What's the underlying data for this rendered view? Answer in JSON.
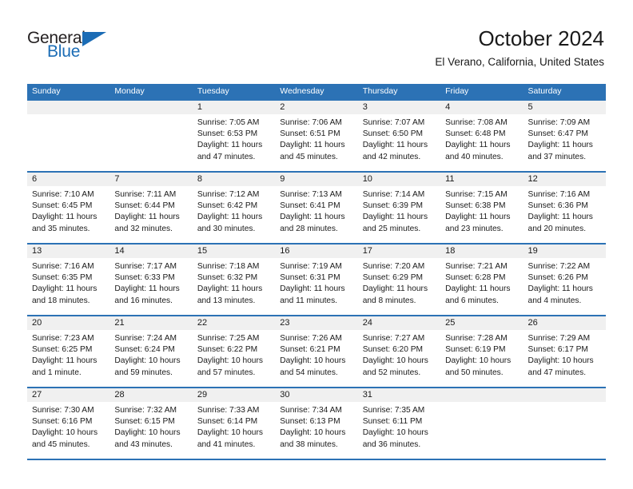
{
  "brand": {
    "name_dark": "General",
    "name_blue": "Blue",
    "accent_color": "#1b6cb5"
  },
  "header": {
    "title": "October 2024",
    "location": "El Verano, California, United States"
  },
  "theme": {
    "header_blue": "#2c72b5",
    "band_gray": "#f0f0f0",
    "text_color": "#1a1a1a"
  },
  "calendar": {
    "weekday_headers": [
      "Sunday",
      "Monday",
      "Tuesday",
      "Wednesday",
      "Thursday",
      "Friday",
      "Saturday"
    ],
    "weeks": [
      [
        {
          "day": "",
          "sunrise": "",
          "sunset": "",
          "daylight1": "",
          "daylight2": "",
          "empty": true
        },
        {
          "day": "",
          "sunrise": "",
          "sunset": "",
          "daylight1": "",
          "daylight2": "",
          "empty": true
        },
        {
          "day": "1",
          "sunrise": "Sunrise: 7:05 AM",
          "sunset": "Sunset: 6:53 PM",
          "daylight1": "Daylight: 11 hours",
          "daylight2": "and 47 minutes."
        },
        {
          "day": "2",
          "sunrise": "Sunrise: 7:06 AM",
          "sunset": "Sunset: 6:51 PM",
          "daylight1": "Daylight: 11 hours",
          "daylight2": "and 45 minutes."
        },
        {
          "day": "3",
          "sunrise": "Sunrise: 7:07 AM",
          "sunset": "Sunset: 6:50 PM",
          "daylight1": "Daylight: 11 hours",
          "daylight2": "and 42 minutes."
        },
        {
          "day": "4",
          "sunrise": "Sunrise: 7:08 AM",
          "sunset": "Sunset: 6:48 PM",
          "daylight1": "Daylight: 11 hours",
          "daylight2": "and 40 minutes."
        },
        {
          "day": "5",
          "sunrise": "Sunrise: 7:09 AM",
          "sunset": "Sunset: 6:47 PM",
          "daylight1": "Daylight: 11 hours",
          "daylight2": "and 37 minutes."
        }
      ],
      [
        {
          "day": "6",
          "sunrise": "Sunrise: 7:10 AM",
          "sunset": "Sunset: 6:45 PM",
          "daylight1": "Daylight: 11 hours",
          "daylight2": "and 35 minutes."
        },
        {
          "day": "7",
          "sunrise": "Sunrise: 7:11 AM",
          "sunset": "Sunset: 6:44 PM",
          "daylight1": "Daylight: 11 hours",
          "daylight2": "and 32 minutes."
        },
        {
          "day": "8",
          "sunrise": "Sunrise: 7:12 AM",
          "sunset": "Sunset: 6:42 PM",
          "daylight1": "Daylight: 11 hours",
          "daylight2": "and 30 minutes."
        },
        {
          "day": "9",
          "sunrise": "Sunrise: 7:13 AM",
          "sunset": "Sunset: 6:41 PM",
          "daylight1": "Daylight: 11 hours",
          "daylight2": "and 28 minutes."
        },
        {
          "day": "10",
          "sunrise": "Sunrise: 7:14 AM",
          "sunset": "Sunset: 6:39 PM",
          "daylight1": "Daylight: 11 hours",
          "daylight2": "and 25 minutes."
        },
        {
          "day": "11",
          "sunrise": "Sunrise: 7:15 AM",
          "sunset": "Sunset: 6:38 PM",
          "daylight1": "Daylight: 11 hours",
          "daylight2": "and 23 minutes."
        },
        {
          "day": "12",
          "sunrise": "Sunrise: 7:16 AM",
          "sunset": "Sunset: 6:36 PM",
          "daylight1": "Daylight: 11 hours",
          "daylight2": "and 20 minutes."
        }
      ],
      [
        {
          "day": "13",
          "sunrise": "Sunrise: 7:16 AM",
          "sunset": "Sunset: 6:35 PM",
          "daylight1": "Daylight: 11 hours",
          "daylight2": "and 18 minutes."
        },
        {
          "day": "14",
          "sunrise": "Sunrise: 7:17 AM",
          "sunset": "Sunset: 6:33 PM",
          "daylight1": "Daylight: 11 hours",
          "daylight2": "and 16 minutes."
        },
        {
          "day": "15",
          "sunrise": "Sunrise: 7:18 AM",
          "sunset": "Sunset: 6:32 PM",
          "daylight1": "Daylight: 11 hours",
          "daylight2": "and 13 minutes."
        },
        {
          "day": "16",
          "sunrise": "Sunrise: 7:19 AM",
          "sunset": "Sunset: 6:31 PM",
          "daylight1": "Daylight: 11 hours",
          "daylight2": "and 11 minutes."
        },
        {
          "day": "17",
          "sunrise": "Sunrise: 7:20 AM",
          "sunset": "Sunset: 6:29 PM",
          "daylight1": "Daylight: 11 hours",
          "daylight2": "and 8 minutes."
        },
        {
          "day": "18",
          "sunrise": "Sunrise: 7:21 AM",
          "sunset": "Sunset: 6:28 PM",
          "daylight1": "Daylight: 11 hours",
          "daylight2": "and 6 minutes."
        },
        {
          "day": "19",
          "sunrise": "Sunrise: 7:22 AM",
          "sunset": "Sunset: 6:26 PM",
          "daylight1": "Daylight: 11 hours",
          "daylight2": "and 4 minutes."
        }
      ],
      [
        {
          "day": "20",
          "sunrise": "Sunrise: 7:23 AM",
          "sunset": "Sunset: 6:25 PM",
          "daylight1": "Daylight: 11 hours",
          "daylight2": "and 1 minute."
        },
        {
          "day": "21",
          "sunrise": "Sunrise: 7:24 AM",
          "sunset": "Sunset: 6:24 PM",
          "daylight1": "Daylight: 10 hours",
          "daylight2": "and 59 minutes."
        },
        {
          "day": "22",
          "sunrise": "Sunrise: 7:25 AM",
          "sunset": "Sunset: 6:22 PM",
          "daylight1": "Daylight: 10 hours",
          "daylight2": "and 57 minutes."
        },
        {
          "day": "23",
          "sunrise": "Sunrise: 7:26 AM",
          "sunset": "Sunset: 6:21 PM",
          "daylight1": "Daylight: 10 hours",
          "daylight2": "and 54 minutes."
        },
        {
          "day": "24",
          "sunrise": "Sunrise: 7:27 AM",
          "sunset": "Sunset: 6:20 PM",
          "daylight1": "Daylight: 10 hours",
          "daylight2": "and 52 minutes."
        },
        {
          "day": "25",
          "sunrise": "Sunrise: 7:28 AM",
          "sunset": "Sunset: 6:19 PM",
          "daylight1": "Daylight: 10 hours",
          "daylight2": "and 50 minutes."
        },
        {
          "day": "26",
          "sunrise": "Sunrise: 7:29 AM",
          "sunset": "Sunset: 6:17 PM",
          "daylight1": "Daylight: 10 hours",
          "daylight2": "and 47 minutes."
        }
      ],
      [
        {
          "day": "27",
          "sunrise": "Sunrise: 7:30 AM",
          "sunset": "Sunset: 6:16 PM",
          "daylight1": "Daylight: 10 hours",
          "daylight2": "and 45 minutes."
        },
        {
          "day": "28",
          "sunrise": "Sunrise: 7:32 AM",
          "sunset": "Sunset: 6:15 PM",
          "daylight1": "Daylight: 10 hours",
          "daylight2": "and 43 minutes."
        },
        {
          "day": "29",
          "sunrise": "Sunrise: 7:33 AM",
          "sunset": "Sunset: 6:14 PM",
          "daylight1": "Daylight: 10 hours",
          "daylight2": "and 41 minutes."
        },
        {
          "day": "30",
          "sunrise": "Sunrise: 7:34 AM",
          "sunset": "Sunset: 6:13 PM",
          "daylight1": "Daylight: 10 hours",
          "daylight2": "and 38 minutes."
        },
        {
          "day": "31",
          "sunrise": "Sunrise: 7:35 AM",
          "sunset": "Sunset: 6:11 PM",
          "daylight1": "Daylight: 10 hours",
          "daylight2": "and 36 minutes."
        },
        {
          "day": "",
          "sunrise": "",
          "sunset": "",
          "daylight1": "",
          "daylight2": "",
          "empty": true
        },
        {
          "day": "",
          "sunrise": "",
          "sunset": "",
          "daylight1": "",
          "daylight2": "",
          "empty": true
        }
      ]
    ]
  }
}
